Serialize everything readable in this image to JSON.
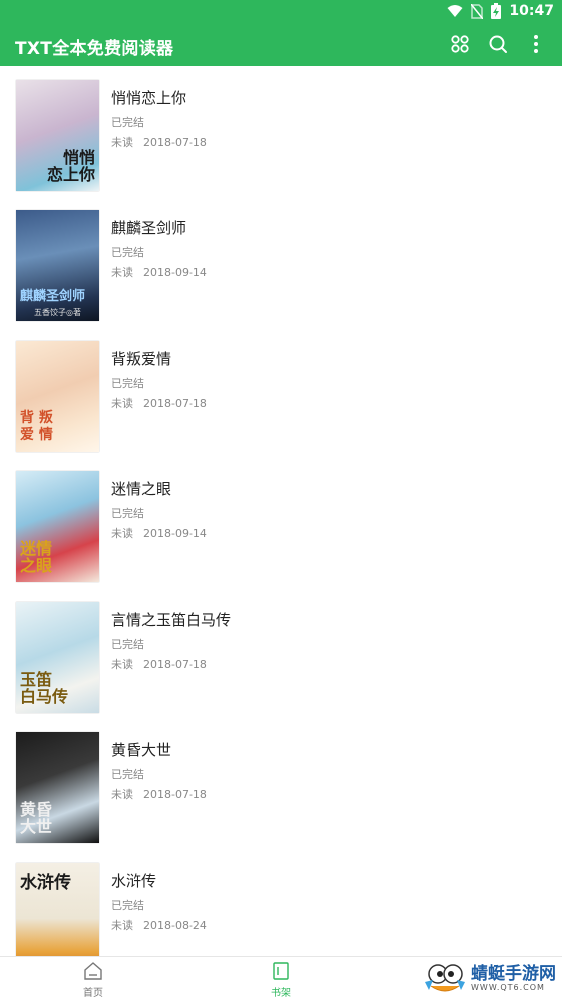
{
  "status_bar": {
    "time": "10:47"
  },
  "app_bar": {
    "title": "TXT全本免费阅读器"
  },
  "books": [
    {
      "title": "悄悄恋上你",
      "status": "已完结",
      "read_state": "未读",
      "date": "2018-07-18",
      "cover_text": "悄悄\n恋上你"
    },
    {
      "title": "麒麟圣剑师",
      "status": "已完结",
      "read_state": "未读",
      "date": "2018-09-14",
      "cover_text": "麒麟圣剑师",
      "cover_author": "五香饺子◎著"
    },
    {
      "title": "背叛爱情",
      "status": "已完结",
      "read_state": "未读",
      "date": "2018-07-18",
      "cover_text": "背 叛\n爱 情"
    },
    {
      "title": "迷情之眼",
      "status": "已完结",
      "read_state": "未读",
      "date": "2018-09-14",
      "cover_text": "迷情\n之眼"
    },
    {
      "title": "言情之玉笛白马传",
      "status": "已完结",
      "read_state": "未读",
      "date": "2018-07-18",
      "cover_text": "玉笛\n白马传"
    },
    {
      "title": "黄昏大世",
      "status": "已完结",
      "read_state": "未读",
      "date": "2018-07-18",
      "cover_text": "黄昏\n大世"
    },
    {
      "title": "水浒传",
      "status": "已完结",
      "read_state": "未读",
      "date": "2018-08-24",
      "cover_text": "水浒传"
    }
  ],
  "bottom_nav": {
    "home": "首页",
    "bookshelf": "书架"
  },
  "watermark": {
    "name": "蜻蜓手游网",
    "url": "WWW.QT6.COM"
  },
  "colors": {
    "primary": "#2eb75c",
    "text": "#222222",
    "muted": "#888888"
  }
}
